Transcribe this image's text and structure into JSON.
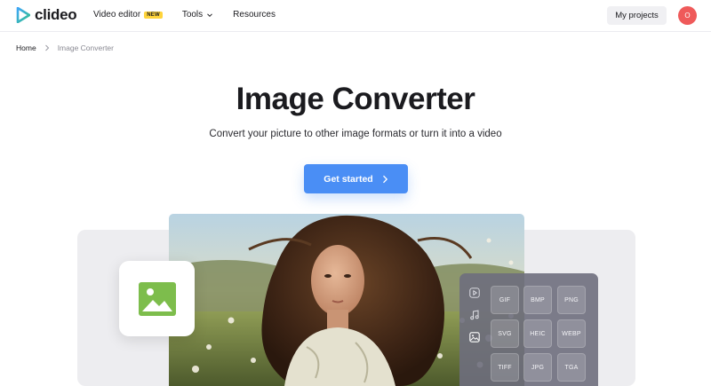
{
  "header": {
    "brand": "clideo",
    "nav": [
      {
        "label": "Video editor",
        "badge": "NEW"
      },
      {
        "label": "Tools"
      },
      {
        "label": "Resources"
      }
    ],
    "projects_label": "My projects",
    "avatar_initial": "O"
  },
  "breadcrumb": {
    "home": "Home",
    "current": "Image Converter"
  },
  "hero": {
    "title": "Image Converter",
    "subtitle": "Convert your picture to other image formats or turn it into a video",
    "cta_label": "Get started"
  },
  "panel": {
    "side_icons": [
      "play-icon",
      "music-note-icon",
      "image-icon"
    ],
    "formats": [
      "GIF",
      "BMP",
      "PNG",
      "SVG",
      "HEIC",
      "WEBP",
      "TIFF",
      "JPG",
      "TGA"
    ]
  },
  "colors": {
    "accent": "#4a8ef5",
    "badge": "#ffd43b",
    "avatar": "#ef5a5a",
    "image_icon": "#7dbd4c"
  }
}
